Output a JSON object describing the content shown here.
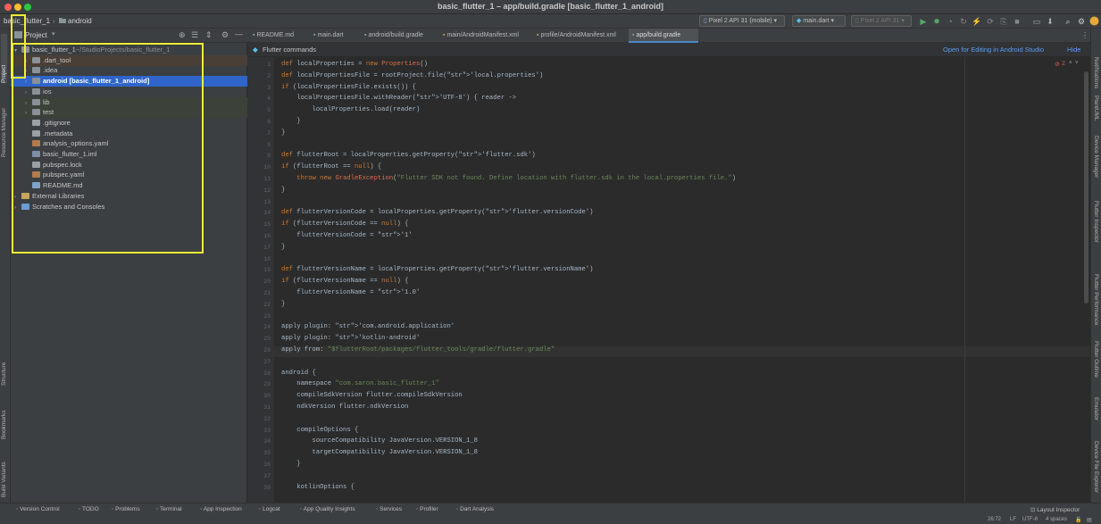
{
  "window": {
    "title": "basic_flutter_1 – app/build.gradle [basic_flutter_1_android]"
  },
  "breadcrumb": {
    "root": "basic_flutter_1",
    "sep": "›",
    "folder": "android"
  },
  "toolbar": {
    "device": "Pixel 2 API 31 (mobile)",
    "config": "main.dart",
    "target": "Pixel 2 API 31"
  },
  "project_panel": {
    "title": "Project",
    "items": [
      {
        "label": "basic_flutter_1",
        "suffix": "~/StudioProjects/basic_flutter_1",
        "level": 0,
        "icon": "folder-icon",
        "arrow": "▾"
      },
      {
        "label": ".dart_tool",
        "level": 1,
        "icon": "folder-icon",
        "arrow": "›"
      },
      {
        "label": ".idea",
        "level": 1,
        "icon": "folder-icon",
        "arrow": "›"
      },
      {
        "label": "android [basic_flutter_1_android]",
        "level": 1,
        "icon": "folder-icon",
        "arrow": "›",
        "selected": true
      },
      {
        "label": "ios",
        "level": 1,
        "icon": "folder-icon",
        "arrow": "›"
      },
      {
        "label": "lib",
        "level": 1,
        "icon": "folder-icon",
        "arrow": "›"
      },
      {
        "label": "test",
        "level": 1,
        "icon": "folder-icon",
        "arrow": "›"
      },
      {
        "label": ".gitignore",
        "level": 1,
        "icon": "file-icon",
        "arrow": ""
      },
      {
        "label": ".metadata",
        "level": 1,
        "icon": "file-icon",
        "arrow": ""
      },
      {
        "label": "analysis_options.yaml",
        "level": 1,
        "icon": "yaml-icon",
        "arrow": ""
      },
      {
        "label": "basic_flutter_1.iml",
        "level": 1,
        "icon": "iml-icon",
        "arrow": ""
      },
      {
        "label": "pubspec.lock",
        "level": 1,
        "icon": "file-icon",
        "arrow": ""
      },
      {
        "label": "pubspec.yaml",
        "level": 1,
        "icon": "yaml-icon",
        "arrow": ""
      },
      {
        "label": "README.md",
        "level": 1,
        "icon": "markdown-icon",
        "arrow": ""
      },
      {
        "label": "External Libraries",
        "level": 0,
        "icon": "library-icon",
        "arrow": "›"
      },
      {
        "label": "Scratches and Consoles",
        "level": 0,
        "icon": "scratch-icon",
        "arrow": "›"
      }
    ]
  },
  "left_tools": [
    "Project",
    "Resource Manager",
    "Structure",
    "Bookmarks",
    "Build Variants"
  ],
  "right_tools": [
    "Notifications",
    "PlantUML",
    "Device Manager",
    "Flutter Inspector",
    "Flutter Performance",
    "Flutter Outline",
    "Emulator",
    "Device File Explorer"
  ],
  "tabs": [
    {
      "label": "README.md",
      "icon": "markdown-icon"
    },
    {
      "label": "main.dart",
      "icon": "dart-icon"
    },
    {
      "label": "android/build.gradle",
      "icon": "gradle-icon"
    },
    {
      "label": "main/AndroidManifest.xml",
      "icon": "xml-icon"
    },
    {
      "label": "profile/AndroidManifest.xml",
      "icon": "xml-icon"
    },
    {
      "label": "app/build.gradle",
      "icon": "gradle-icon",
      "active": true
    }
  ],
  "banner": {
    "label": "Flutter commands",
    "open_link": "Open for Editing in Android Studio",
    "hide_link": "Hide"
  },
  "inspection": {
    "warnings": "2"
  },
  "code_lines": [
    {
      "n": "1",
      "t": "def localProperties = new Properties()"
    },
    {
      "n": "2",
      "t": "def localPropertiesFile = rootProject.file('local.properties')"
    },
    {
      "n": "3",
      "t": "if (localPropertiesFile.exists()) {"
    },
    {
      "n": "4",
      "t": "    localPropertiesFile.withReader('UTF-8') { reader ->"
    },
    {
      "n": "5",
      "t": "        localProperties.load(reader)"
    },
    {
      "n": "6",
      "t": "    }"
    },
    {
      "n": "7",
      "t": "}"
    },
    {
      "n": "8",
      "t": ""
    },
    {
      "n": "9",
      "t": "def flutterRoot = localProperties.getProperty('flutter.sdk')"
    },
    {
      "n": "10",
      "t": "if (flutterRoot == null) {"
    },
    {
      "n": "11",
      "t": "    throw new GradleException(\"Flutter SDK not found. Define location with flutter.sdk in the local.properties file.\")"
    },
    {
      "n": "12",
      "t": "}"
    },
    {
      "n": "13",
      "t": ""
    },
    {
      "n": "14",
      "t": "def flutterVersionCode = localProperties.getProperty('flutter.versionCode')"
    },
    {
      "n": "15",
      "t": "if (flutterVersionCode == null) {"
    },
    {
      "n": "16",
      "t": "    flutterVersionCode = '1'"
    },
    {
      "n": "17",
      "t": "}"
    },
    {
      "n": "18",
      "t": ""
    },
    {
      "n": "19",
      "t": "def flutterVersionName = localProperties.getProperty('flutter.versionName')"
    },
    {
      "n": "20",
      "t": "if (flutterVersionName == null) {"
    },
    {
      "n": "21",
      "t": "    flutterVersionName = '1.0'"
    },
    {
      "n": "22",
      "t": "}"
    },
    {
      "n": "23",
      "t": ""
    },
    {
      "n": "24",
      "t": "apply plugin: 'com.android.application'"
    },
    {
      "n": "25",
      "t": "apply plugin: 'kotlin-android'"
    },
    {
      "n": "26",
      "t": "apply from: \"$flutterRoot/packages/flutter_tools/gradle/flutter.gradle\""
    },
    {
      "n": "27",
      "t": ""
    },
    {
      "n": "28",
      "t": "android {"
    },
    {
      "n": "29",
      "t": "    namespace \"com.saron.basic_flutter_1\""
    },
    {
      "n": "30",
      "t": "    compileSdkVersion flutter.compileSdkVersion"
    },
    {
      "n": "31",
      "t": "    ndkVersion flutter.ndkVersion"
    },
    {
      "n": "32",
      "t": ""
    },
    {
      "n": "33",
      "t": "    compileOptions {"
    },
    {
      "n": "34",
      "t": "        sourceCompatibility JavaVersion.VERSION_1_8"
    },
    {
      "n": "35",
      "t": "        targetCompatibility JavaVersion.VERSION_1_8"
    },
    {
      "n": "36",
      "t": "    }"
    },
    {
      "n": "37",
      "t": ""
    },
    {
      "n": "38",
      "t": "    kotlinOptions {"
    }
  ],
  "status_tools": [
    {
      "label": "Version Control",
      "icon": "vcs-icon"
    },
    {
      "label": "TODO",
      "icon": "list-icon"
    },
    {
      "label": "Problems",
      "icon": "problems-icon"
    },
    {
      "label": "Terminal",
      "icon": "terminal-icon"
    },
    {
      "label": "App Inspection",
      "icon": "inspection-icon"
    },
    {
      "label": "Logcat",
      "icon": "logcat-icon"
    },
    {
      "label": "App Quality Insights",
      "icon": "quality-icon"
    },
    {
      "label": "Services",
      "icon": "services-icon"
    },
    {
      "label": "Profiler",
      "icon": "profiler-icon"
    },
    {
      "label": "Dart Analysis",
      "icon": "dart-icon"
    }
  ],
  "status_right": {
    "layout_inspector": "Layout Inspector",
    "position": "26:72",
    "line_sep": "LF",
    "encoding": "UTF-8",
    "indent": "4 spaces"
  },
  "colors": {
    "selection": "#2f65ca",
    "highlight_box": "#eded3a",
    "link": "#589df6"
  }
}
